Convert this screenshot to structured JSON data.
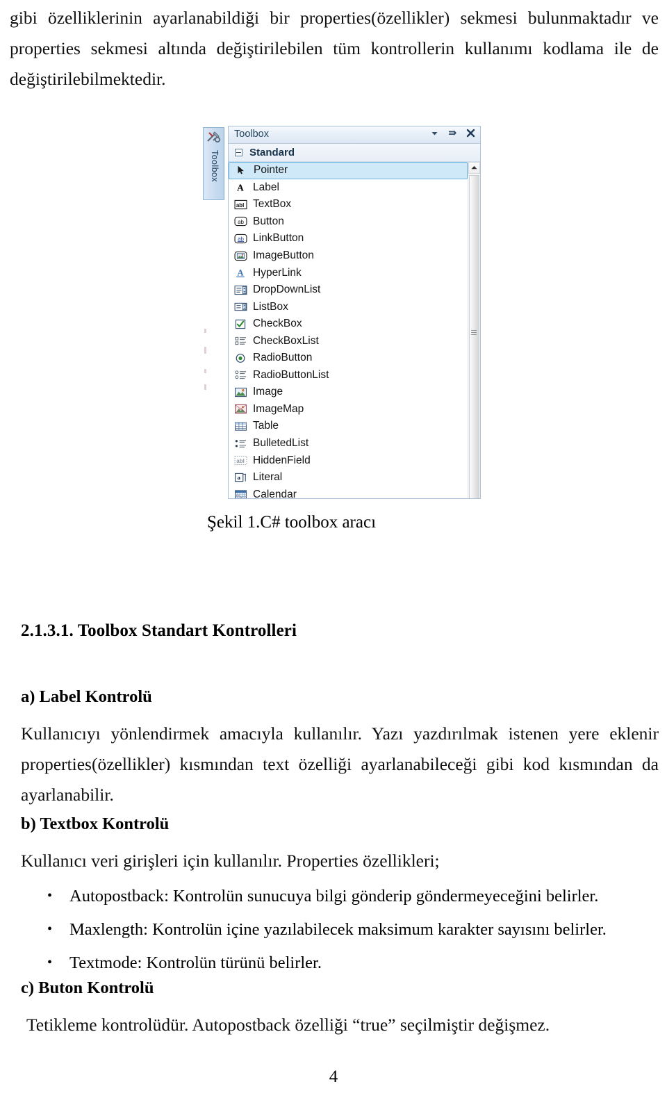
{
  "document": {
    "page_number": "4",
    "lead_paragraph": "gibi özelliklerinin ayarlanabildiği bir properties(özellikler) sekmesi bulunmaktadır ve properties sekmesi altında değiştirilebilen tüm kontrollerin kullanımı kodlama ile de değiştirilebilmektedir.",
    "figure_caption": "Şekil 1.C# toolbox aracı",
    "section_heading": "2.1.3.1.  Toolbox Standart Kontrolleri",
    "subsections": [
      {
        "title": "a) Label Kontrolü",
        "body": "Kullanıcıyı yönlendirmek amacıyla kullanılır. Yazı yazdırılmak istenen yere eklenir properties(özellikler) kısmından text özelliği ayarlanabileceği gibi kod kısmından da ayarlanabilir."
      },
      {
        "title": "b) Textbox Kontrolü",
        "body": "Kullanıcı veri girişleri için kullanılır.  Properties özellikleri;"
      },
      {
        "title": "c) Buton Kontrolü",
        "body": "Tetikleme kontrolüdür.  Autopostback özelliği “true” seçilmiştir değişmez."
      }
    ],
    "bullets": [
      "Autopostback: Kontrolün sunucuya bilgi gönderip göndermeyeceğini belirler.",
      "Maxlength: Kontrolün içine yazılabilecek maksimum karakter sayısını belirler.",
      "Textmode: Kontrolün türünü belirler."
    ]
  },
  "toolbox_figure": {
    "side_tab": {
      "label": "Toolbox",
      "icon": "hammer-wrench-icon"
    },
    "window": {
      "title": "Toolbox",
      "controls": [
        {
          "name": "dropdown-menu-icon",
          "glyph": "▾"
        },
        {
          "name": "auto-hide-pin-icon",
          "glyph": "⇥"
        },
        {
          "name": "close-icon",
          "glyph": "✕"
        }
      ]
    },
    "group": {
      "label": "Standard",
      "expanded": true
    },
    "selected_item": "Pointer",
    "items": [
      {
        "label": "Pointer",
        "icon": "pointer-arrow-icon",
        "selected": true
      },
      {
        "label": "Label",
        "icon": "label-a-icon",
        "selected": false
      },
      {
        "label": "TextBox",
        "icon": "textbox-abl-icon",
        "selected": false
      },
      {
        "label": "Button",
        "icon": "button-ab-icon",
        "selected": false
      },
      {
        "label": "LinkButton",
        "icon": "linkbutton-ab-icon",
        "selected": false
      },
      {
        "label": "ImageButton",
        "icon": "imagebutton-icon",
        "selected": false
      },
      {
        "label": "HyperLink",
        "icon": "hyperlink-a-icon",
        "selected": false
      },
      {
        "label": "DropDownList",
        "icon": "dropdownlist-icon",
        "selected": false
      },
      {
        "label": "ListBox",
        "icon": "listbox-icon",
        "selected": false
      },
      {
        "label": "CheckBox",
        "icon": "checkbox-icon",
        "selected": false
      },
      {
        "label": "CheckBoxList",
        "icon": "checkboxlist-icon",
        "selected": false
      },
      {
        "label": "RadioButton",
        "icon": "radiobutton-icon",
        "selected": false
      },
      {
        "label": "RadioButtonList",
        "icon": "radiobuttonlist-icon",
        "selected": false
      },
      {
        "label": "Image",
        "icon": "image-icon",
        "selected": false
      },
      {
        "label": "ImageMap",
        "icon": "imagemap-icon",
        "selected": false
      },
      {
        "label": "Table",
        "icon": "table-icon",
        "selected": false
      },
      {
        "label": "BulletedList",
        "icon": "bulletedlist-icon",
        "selected": false
      },
      {
        "label": "HiddenField",
        "icon": "hiddenfield-icon",
        "selected": false
      },
      {
        "label": "Literal",
        "icon": "literal-icon",
        "selected": false
      },
      {
        "label": "Calendar",
        "icon": "calendar-icon",
        "selected": false
      }
    ],
    "scrollbar": {
      "up_arrow": "scroll-up-arrow-icon",
      "thumb": "scroll-thumb"
    },
    "colors": {
      "selection_fill": "#cfe9f9",
      "selection_border": "#6ab3de",
      "title_text": "#23465f",
      "tab_fill": "#c9dcf0"
    }
  }
}
